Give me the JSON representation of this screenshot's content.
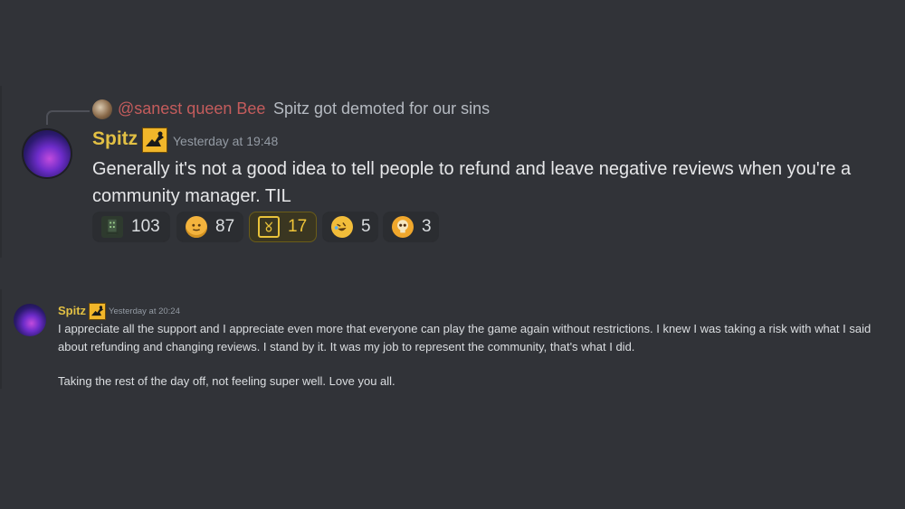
{
  "message1": {
    "reply": {
      "mention": "@sanest queen Bee",
      "text": "Spitz got demoted for our sins"
    },
    "username": "Spitz",
    "timestamp": "Yesterday at 19:48",
    "content": "Generally it's not a good idea to tell people to refund and leave negative reviews when you're a community manager. TIL",
    "reactions": [
      {
        "icon": "tower-emoji-icon",
        "count": "103",
        "active": false
      },
      {
        "icon": "slight-smile-emoji-icon",
        "count": "87",
        "active": false
      },
      {
        "icon": "camera-frame-emoji-icon",
        "count": "17",
        "active": true
      },
      {
        "icon": "rolling-laughing-emoji-icon",
        "count": "5",
        "active": false
      },
      {
        "icon": "skull-emoji-icon",
        "count": "3",
        "active": false
      }
    ]
  },
  "message2": {
    "username": "Spitz",
    "timestamp": "Yesterday at 20:24",
    "paragraph1": "I appreciate all the support and I appreciate even more that everyone can play the game again without restrictions. I knew I was taking a risk with what I said about refunding and changing reviews. I stand by it. It was my job to represent the community, that's what I did.",
    "paragraph2": "Taking the rest of the day off, not feeling super well. Love you all."
  },
  "colors": {
    "background": "#313338",
    "username": "#e2c044",
    "mention": "#c45c5c",
    "timestamp": "#949ba4",
    "active_reaction": "#f0c538"
  }
}
